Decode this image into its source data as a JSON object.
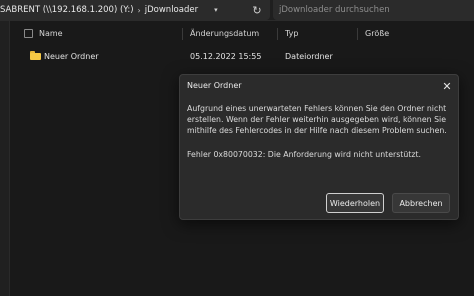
{
  "addressbar": {
    "crumbs": [
      "SABRENT (\\\\192.168.1.200) (Y:)",
      "jDownloader"
    ],
    "separator": "›",
    "dropdown_icon": "chevron-down-icon",
    "refresh_icon": "refresh-icon",
    "search_placeholder": "jDownloader durchsuchen"
  },
  "columns": {
    "name": "Name",
    "modified": "Änderungsdatum",
    "type": "Typ",
    "size": "Größe"
  },
  "rows": [
    {
      "name": "Neuer Ordner",
      "modified": "05.12.2022 15:55",
      "type": "Dateiordner",
      "size": ""
    }
  ],
  "dialog": {
    "title": "Neuer Ordner",
    "message": "Aufgrund eines unerwarteten Fehlers können Sie den Ordner nicht erstellen. Wenn der Fehler weiterhin ausgegeben wird, können Sie mithilfe des Fehlercodes in der Hilfe nach diesem Problem suchen.",
    "error": "Fehler 0x80070032: Die Anforderung wird nicht unterstützt.",
    "retry_label": "Wiederholen",
    "cancel_label": "Abbrechen",
    "close_glyph": "✕"
  },
  "colors": {
    "background": "#191919",
    "dialog": "#2b2b2b",
    "folder": "#f7c945"
  }
}
